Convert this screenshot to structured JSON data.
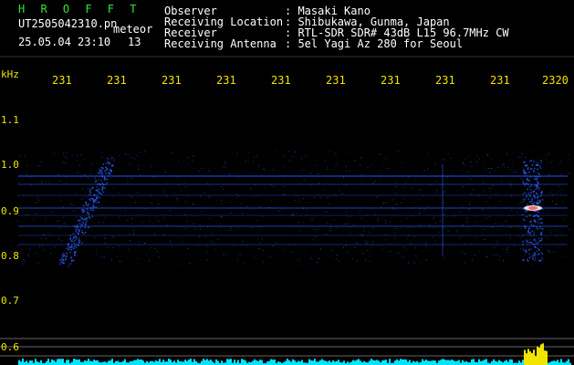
{
  "app": {
    "name": "H R O F F T"
  },
  "file": {
    "name": "UT2505042310.pn",
    "tag": "meteor",
    "datetime": "25.05.04 23:10",
    "count": "13"
  },
  "info": [
    {
      "label": "Observer",
      "value": ": Masaki Kano"
    },
    {
      "label": "Receiving Location",
      "value": ": Shibukawa, Gunma, Japan"
    },
    {
      "label": "Receiver",
      "value": ": RTL-SDR SDR# 43dB L15 96.7MHz CW"
    },
    {
      "label": "Receiving Antenna",
      "value": ": 5el Yagi Az 280 for Seoul"
    }
  ],
  "y_axis": {
    "unit": "kHz",
    "ticks": [
      "1.1",
      "1.0",
      "0.9",
      "0.8",
      "0.7",
      "0.6"
    ]
  },
  "x_axis": {
    "ticks": [
      "231",
      "231",
      "231",
      "231",
      "231",
      "231",
      "231",
      "231",
      "231",
      "2320"
    ]
  },
  "colors": {
    "signal": "#2a5cff",
    "axis_text": "#f2e400",
    "title": "#2ee82e",
    "baseline": "#00e5ff"
  }
}
